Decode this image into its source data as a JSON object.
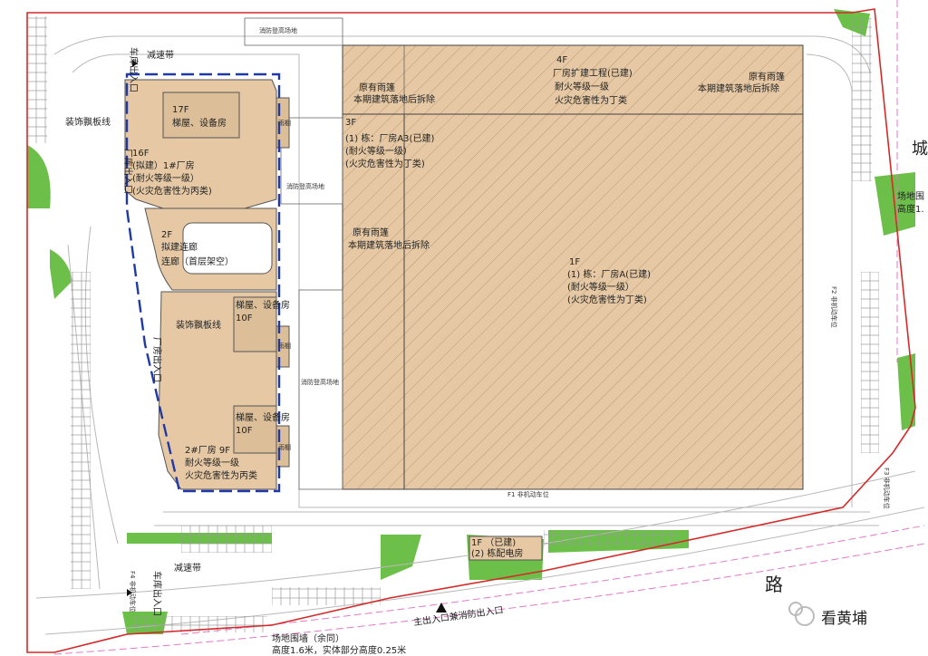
{
  "colors": {
    "building_fill": "#e6c9a4",
    "building_fill_2": "#dcbf98",
    "green": "#6cc04a",
    "boundary": "#d42a2a",
    "dashed_blue": "#1f3aa8",
    "road_lines": "#b8b8b8",
    "pink_line": "#e07ac8"
  },
  "labels": {
    "fire_platform_top": "消防登高场地",
    "garage_exit_top": "车库出入口",
    "speed_bump_top": "减速带",
    "deco_line_1": "装饰飘板线",
    "factory_exit_1": "厂库出入口",
    "b1_17f_1": "17F",
    "b1_17f_2": "梯屋、设备房",
    "b1_16f_1": "16F",
    "b1_16f_2": "(拟建）1#厂房",
    "b1_16f_3": "(耐火等级一级）",
    "b1_16f_4": "(火灾危害性为丙类)",
    "canopy_1": "雨棚",
    "corridor_1": "2F",
    "corridor_2": "拟建连廊",
    "corridor_3": "连廊（首层架空）",
    "deco_line_2": "装饰飘板线",
    "factory_exit_2": "厂房出入口",
    "b2_10f_a_1": "梯屋、设备房",
    "b2_10f_a_2": "10F",
    "canopy_2": "雨棚",
    "b2_10f_b_1": "梯屋、设备房",
    "b2_10f_b_2": "10F",
    "canopy_3": "雨棚",
    "b2_9f_1": "2#厂房  9F",
    "b2_9f_2": "耐火等级一级",
    "b2_9f_3": "火灾危害性为丙类",
    "fire_platform_mid": "消防登高场地",
    "fire_platform_low": "消防登高场地",
    "canopy_demolish_1a": "原有雨篷",
    "canopy_demolish_1b": "本期建筑落地后拆除",
    "ext_4f_1": "4F",
    "ext_4f_2": "厂房扩建工程(已建)",
    "ext_4f_3": "耐火等级一级",
    "ext_4f_4": "火灾危害性为丁类",
    "canopy_demolish_2a": "原有雨篷",
    "canopy_demolish_2b": "本期建筑落地后拆除",
    "a3_1": "3F",
    "a3_2": "(1) 栋：厂房A3(已建)",
    "a3_3": "(耐火等级一级）",
    "a3_4": "(火灾危害性为丁类)",
    "canopy_demolish_3a": "原有雨篷",
    "canopy_demolish_3b": "本期建筑落地后拆除",
    "a_1": "1F",
    "a_2": "(1) 栋：厂房A(已建)",
    "a_3": "(耐火等级一级）",
    "a_4": "(火灾危害性为丁类)",
    "f2_parking": "F2 非机动车位",
    "f1_parking": "F1 非机动车位",
    "f3_parking": "F3 非机动车位",
    "f4_parking": "F4 非机动车位",
    "garage_exit_bottom": "车库出入口",
    "speed_bump_bottom": "减速带",
    "substation_1": "1F （已建)",
    "substation_2": "(2) 栋配电房",
    "road": "路",
    "main_entrance": "主出入口兼消防出入口",
    "wall_1": "场地围墙（余同）",
    "wall_2": "高度1.6米，实体部分高度0.25米",
    "right_edge_1": "场地围",
    "right_edge_2": "高度1.",
    "right_edge_char": "城",
    "watermark": "看黄埔"
  }
}
